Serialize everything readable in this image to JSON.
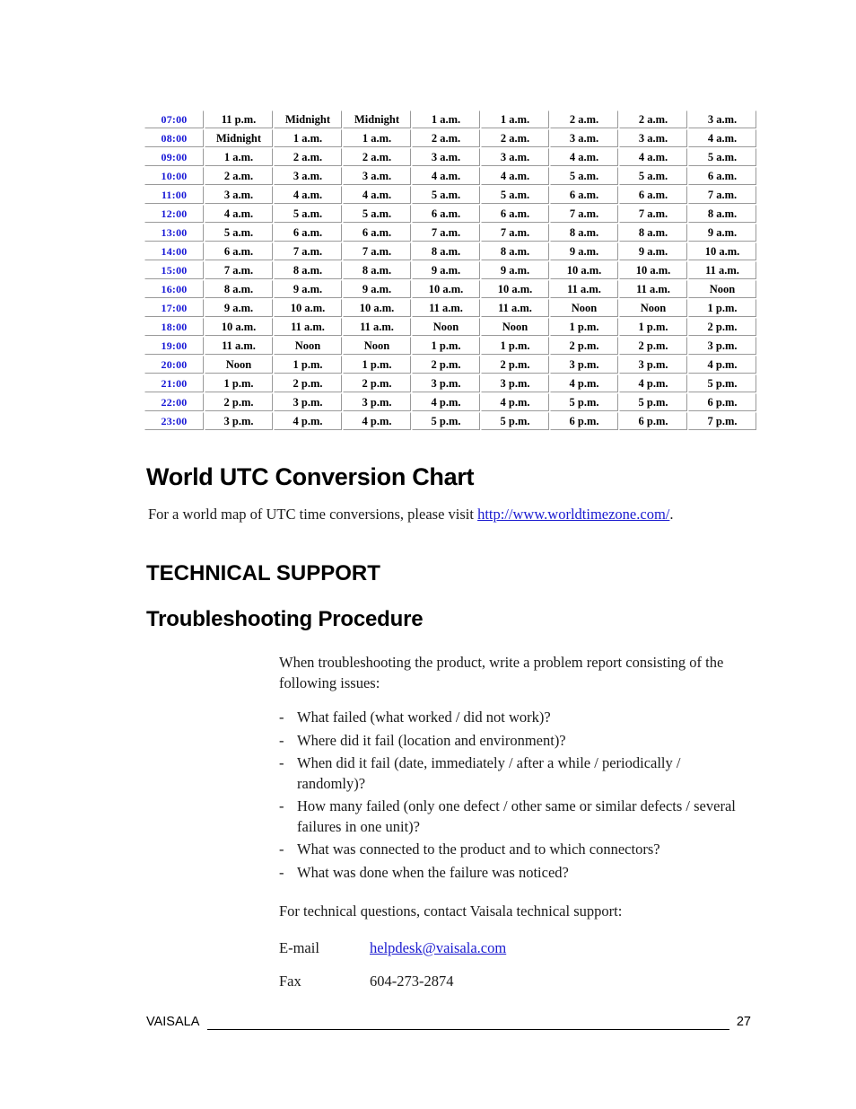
{
  "table": {
    "name": "utc-conversion-table",
    "utc_column_color": "#1717d6",
    "rows": [
      {
        "utc": "07:00",
        "cells": [
          "11 p.m.",
          "Midnight",
          "Midnight",
          "1 a.m.",
          "1 a.m.",
          "2 a.m.",
          "2 a.m.",
          "3 a.m."
        ]
      },
      {
        "utc": "08:00",
        "cells": [
          "Midnight",
          "1 a.m.",
          "1 a.m.",
          "2 a.m.",
          "2 a.m.",
          "3 a.m.",
          "3 a.m.",
          "4 a.m."
        ]
      },
      {
        "utc": "09:00",
        "cells": [
          "1 a.m.",
          "2 a.m.",
          "2 a.m.",
          "3 a.m.",
          "3 a.m.",
          "4 a.m.",
          "4 a.m.",
          "5 a.m."
        ]
      },
      {
        "utc": "10:00",
        "cells": [
          "2 a.m.",
          "3 a.m.",
          "3 a.m.",
          "4 a.m.",
          "4 a.m.",
          "5 a.m.",
          "5 a.m.",
          "6 a.m."
        ]
      },
      {
        "utc": "11:00",
        "cells": [
          "3 a.m.",
          "4 a.m.",
          "4 a.m.",
          "5 a.m.",
          "5 a.m.",
          "6 a.m.",
          "6 a.m.",
          "7 a.m."
        ]
      },
      {
        "utc": "12:00",
        "cells": [
          "4 a.m.",
          "5 a.m.",
          "5 a.m.",
          "6 a.m.",
          "6 a.m.",
          "7 a.m.",
          "7 a.m.",
          "8 a.m."
        ]
      },
      {
        "utc": "13:00",
        "cells": [
          "5 a.m.",
          "6 a.m.",
          "6 a.m.",
          "7 a.m.",
          "7 a.m.",
          "8 a.m.",
          "8 a.m.",
          "9 a.m."
        ]
      },
      {
        "utc": "14:00",
        "cells": [
          "6 a.m.",
          "7 a.m.",
          "7 a.m.",
          "8 a.m.",
          "8 a.m.",
          "9 a.m.",
          "9 a.m.",
          "10 a.m."
        ]
      },
      {
        "utc": "15:00",
        "cells": [
          "7 a.m.",
          "8 a.m.",
          "8 a.m.",
          "9 a.m.",
          "9 a.m.",
          "10 a.m.",
          "10 a.m.",
          "11 a.m."
        ]
      },
      {
        "utc": "16:00",
        "cells": [
          "8 a.m.",
          "9 a.m.",
          "9 a.m.",
          "10 a.m.",
          "10 a.m.",
          "11 a.m.",
          "11 a.m.",
          "Noon"
        ]
      },
      {
        "utc": "17:00",
        "cells": [
          "9 a.m.",
          "10 a.m.",
          "10 a.m.",
          "11 a.m.",
          "11 a.m.",
          "Noon",
          "Noon",
          "1 p.m."
        ]
      },
      {
        "utc": "18:00",
        "cells": [
          "10 a.m.",
          "11 a.m.",
          "11 a.m.",
          "Noon",
          "Noon",
          "1 p.m.",
          "1 p.m.",
          "2 p.m."
        ]
      },
      {
        "utc": "19:00",
        "cells": [
          "11 a.m.",
          "Noon",
          "Noon",
          "1 p.m.",
          "1 p.m.",
          "2 p.m.",
          "2 p.m.",
          "3 p.m."
        ]
      },
      {
        "utc": "20:00",
        "cells": [
          "Noon",
          "1 p.m.",
          "1 p.m.",
          "2 p.m.",
          "2 p.m.",
          "3 p.m.",
          "3 p.m.",
          "4 p.m."
        ]
      },
      {
        "utc": "21:00",
        "cells": [
          "1 p.m.",
          "2 p.m.",
          "2 p.m.",
          "3 p.m.",
          "3 p.m.",
          "4 p.m.",
          "4 p.m.",
          "5 p.m."
        ]
      },
      {
        "utc": "22:00",
        "cells": [
          "2 p.m.",
          "3 p.m.",
          "3 p.m.",
          "4 p.m.",
          "4 p.m.",
          "5 p.m.",
          "5 p.m.",
          "6 p.m."
        ]
      },
      {
        "utc": "23:00",
        "cells": [
          "3 p.m.",
          "4 p.m.",
          "4 p.m.",
          "5 p.m.",
          "5 p.m.",
          "6 p.m.",
          "6 p.m.",
          "7 p.m."
        ]
      }
    ]
  },
  "headings": {
    "world_utc": "World UTC Conversion Chart",
    "technical_support": "TECHNICAL SUPPORT",
    "troubleshooting": "Troubleshooting Procedure"
  },
  "intro": {
    "before_link": "For a world map of UTC time conversions, please visit ",
    "link_text": "http://www.worldtimezone.com/",
    "link_color": "#1a1ad0",
    "after_link": "."
  },
  "troubleshooting": {
    "intro": "When troubleshooting the product, write a problem report consisting of the following issues:",
    "bullet_marker": "-",
    "bullets": [
      "What failed (what worked / did not work)?",
      "Where did it fail (location and environment)?",
      "When did it fail (date, immediately / after a while / periodically / randomly)?",
      "How many failed (only one defect / other same or similar defects / several failures in one unit)?",
      "What was connected to the product and to which connectors?",
      "What was done when the failure was noticed?"
    ],
    "contact_intro": "For technical questions, contact Vaisala technical support:",
    "contacts": [
      {
        "label": "E-mail",
        "value": "helpdesk@vaisala.com",
        "is_link": true
      },
      {
        "label": "Fax",
        "value": "604-273-2874",
        "is_link": false
      }
    ]
  },
  "footer": {
    "company": "VAISALA",
    "page_number": "27"
  }
}
